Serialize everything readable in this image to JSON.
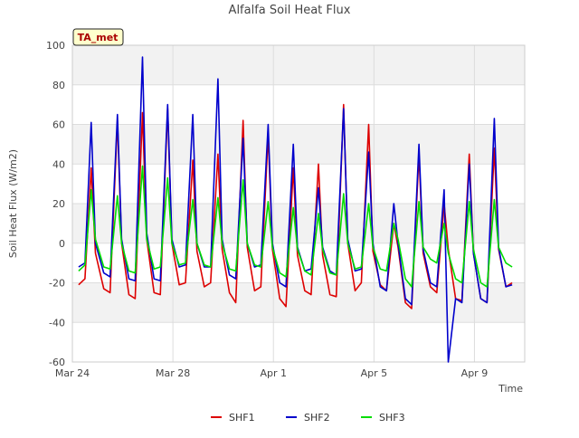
{
  "chart_data": {
    "type": "line",
    "title": "Alfalfa Soil Heat Flux",
    "xlabel": "Time",
    "ylabel": "Soil Heat Flux (W/m2)",
    "annotation": "TA_met",
    "ylim": [
      -60,
      100
    ],
    "yticks": [
      -60,
      -40,
      -20,
      0,
      20,
      40,
      60,
      80,
      100
    ],
    "xlim": [
      "2023-03-24",
      "2023-04-11"
    ],
    "xticks": [
      {
        "date": "2023-03-24",
        "label": "Mar 24"
      },
      {
        "date": "2023-03-28",
        "label": "Mar 28"
      },
      {
        "date": "2023-04-01",
        "label": "Apr 1"
      },
      {
        "date": "2023-04-05",
        "label": "Apr 5"
      },
      {
        "date": "2023-04-09",
        "label": "Apr 9"
      }
    ],
    "grid": true,
    "legend_position": "bottom-center",
    "series": [
      {
        "name": "SHF1",
        "color": "#dd0000",
        "points": [
          [
            "2023-03-24T06:00",
            -21
          ],
          [
            "2023-03-24T12:00",
            -18
          ],
          [
            "2023-03-24T18:00",
            38
          ],
          [
            "2023-03-24T22:00",
            -5
          ],
          [
            "2023-03-25T06:00",
            -23
          ],
          [
            "2023-03-25T12:00",
            -25
          ],
          [
            "2023-03-25T19:00",
            62
          ],
          [
            "2023-03-25T23:00",
            0
          ],
          [
            "2023-03-26T06:00",
            -26
          ],
          [
            "2023-03-26T12:00",
            -28
          ],
          [
            "2023-03-26T19:00",
            66
          ],
          [
            "2023-03-26T23:00",
            2
          ],
          [
            "2023-03-27T06:00",
            -25
          ],
          [
            "2023-03-27T12:00",
            -26
          ],
          [
            "2023-03-27T19:00",
            68
          ],
          [
            "2023-03-27T23:00",
            0
          ],
          [
            "2023-03-28T06:00",
            -21
          ],
          [
            "2023-03-28T12:00",
            -20
          ],
          [
            "2023-03-28T19:00",
            42
          ],
          [
            "2023-03-28T23:00",
            -4
          ],
          [
            "2023-03-29T06:00",
            -22
          ],
          [
            "2023-03-29T12:00",
            -20
          ],
          [
            "2023-03-29T19:00",
            45
          ],
          [
            "2023-03-29T23:00",
            -3
          ],
          [
            "2023-03-30T06:00",
            -25
          ],
          [
            "2023-03-30T12:00",
            -30
          ],
          [
            "2023-03-30T19:00",
            62
          ],
          [
            "2023-03-30T23:00",
            -2
          ],
          [
            "2023-03-31T06:00",
            -24
          ],
          [
            "2023-03-31T12:00",
            -22
          ],
          [
            "2023-03-31T19:00",
            55
          ],
          [
            "2023-03-31T23:00",
            -3
          ],
          [
            "2023-04-01T06:00",
            -28
          ],
          [
            "2023-04-01T12:00",
            -32
          ],
          [
            "2023-04-01T19:00",
            38
          ],
          [
            "2023-04-01T23:00",
            -6
          ],
          [
            "2023-04-02T06:00",
            -24
          ],
          [
            "2023-04-02T12:00",
            -26
          ],
          [
            "2023-04-02T19:00",
            40
          ],
          [
            "2023-04-02T23:00",
            -6
          ],
          [
            "2023-04-03T06:00",
            -26
          ],
          [
            "2023-04-03T12:00",
            -27
          ],
          [
            "2023-04-03T19:00",
            70
          ],
          [
            "2023-04-03T23:00",
            0
          ],
          [
            "2023-04-04T06:00",
            -24
          ],
          [
            "2023-04-04T12:00",
            -20
          ],
          [
            "2023-04-04T19:00",
            60
          ],
          [
            "2023-04-04T23:00",
            -4
          ],
          [
            "2023-04-05T06:00",
            -21
          ],
          [
            "2023-04-05T12:00",
            -24
          ],
          [
            "2023-04-05T19:00",
            10
          ],
          [
            "2023-04-05T23:00",
            -2
          ],
          [
            "2023-04-06T06:00",
            -30
          ],
          [
            "2023-04-06T12:00",
            -33
          ],
          [
            "2023-04-06T19:00",
            45
          ],
          [
            "2023-04-06T23:00",
            -5
          ],
          [
            "2023-04-07T06:00",
            -22
          ],
          [
            "2023-04-07T12:00",
            -25
          ],
          [
            "2023-04-07T19:00",
            20
          ],
          [
            "2023-04-07T23:00",
            -3
          ],
          [
            "2023-04-08T06:00",
            -28
          ],
          [
            "2023-04-08T12:00",
            -29
          ],
          [
            "2023-04-08T19:00",
            45
          ],
          [
            "2023-04-08T23:00",
            -5
          ],
          [
            "2023-04-09T06:00",
            -28
          ],
          [
            "2023-04-09T12:00",
            -30
          ],
          [
            "2023-04-09T19:00",
            48
          ],
          [
            "2023-04-09T23:00",
            -3
          ],
          [
            "2023-04-10T06:00",
            -22
          ],
          [
            "2023-04-10T12:00",
            -20
          ]
        ]
      },
      {
        "name": "SHF2",
        "color": "#0000cc",
        "points": [
          [
            "2023-03-24T06:00",
            -12
          ],
          [
            "2023-03-24T12:00",
            -10
          ],
          [
            "2023-03-24T18:00",
            61
          ],
          [
            "2023-03-24T22:00",
            0
          ],
          [
            "2023-03-25T06:00",
            -15
          ],
          [
            "2023-03-25T12:00",
            -17
          ],
          [
            "2023-03-25T19:00",
            65
          ],
          [
            "2023-03-25T23:00",
            2
          ],
          [
            "2023-03-26T06:00",
            -18
          ],
          [
            "2023-03-26T12:00",
            -19
          ],
          [
            "2023-03-26T19:00",
            94
          ],
          [
            "2023-03-26T23:00",
            5
          ],
          [
            "2023-03-27T06:00",
            -18
          ],
          [
            "2023-03-27T12:00",
            -19
          ],
          [
            "2023-03-27T19:00",
            70
          ],
          [
            "2023-03-27T23:00",
            2
          ],
          [
            "2023-03-28T06:00",
            -12
          ],
          [
            "2023-03-28T12:00",
            -11
          ],
          [
            "2023-03-28T19:00",
            65
          ],
          [
            "2023-03-28T23:00",
            0
          ],
          [
            "2023-03-29T06:00",
            -12
          ],
          [
            "2023-03-29T12:00",
            -12
          ],
          [
            "2023-03-29T19:00",
            83
          ],
          [
            "2023-03-29T23:00",
            2
          ],
          [
            "2023-03-30T06:00",
            -16
          ],
          [
            "2023-03-30T12:00",
            -18
          ],
          [
            "2023-03-30T19:00",
            53
          ],
          [
            "2023-03-30T23:00",
            0
          ],
          [
            "2023-03-31T06:00",
            -12
          ],
          [
            "2023-03-31T12:00",
            -11
          ],
          [
            "2023-03-31T19:00",
            60
          ],
          [
            "2023-03-31T23:00",
            0
          ],
          [
            "2023-04-01T06:00",
            -20
          ],
          [
            "2023-04-01T12:00",
            -22
          ],
          [
            "2023-04-01T19:00",
            50
          ],
          [
            "2023-04-01T23:00",
            -2
          ],
          [
            "2023-04-02T06:00",
            -14
          ],
          [
            "2023-04-02T12:00",
            -13
          ],
          [
            "2023-04-02T19:00",
            28
          ],
          [
            "2023-04-02T23:00",
            -2
          ],
          [
            "2023-04-03T06:00",
            -14
          ],
          [
            "2023-04-03T12:00",
            -16
          ],
          [
            "2023-04-03T19:00",
            68
          ],
          [
            "2023-04-03T23:00",
            2
          ],
          [
            "2023-04-04T06:00",
            -14
          ],
          [
            "2023-04-04T12:00",
            -13
          ],
          [
            "2023-04-04T19:00",
            46
          ],
          [
            "2023-04-04T23:00",
            0
          ],
          [
            "2023-04-05T06:00",
            -22
          ],
          [
            "2023-04-05T12:00",
            -24
          ],
          [
            "2023-04-05T19:00",
            20
          ],
          [
            "2023-04-05T23:00",
            0
          ],
          [
            "2023-04-06T06:00",
            -28
          ],
          [
            "2023-04-06T12:00",
            -31
          ],
          [
            "2023-04-06T19:00",
            50
          ],
          [
            "2023-04-06T23:00",
            -3
          ],
          [
            "2023-04-07T06:00",
            -20
          ],
          [
            "2023-04-07T12:00",
            -22
          ],
          [
            "2023-04-07T19:00",
            27
          ],
          [
            "2023-04-07T23:00",
            -60
          ],
          [
            "2023-04-08T06:00",
            -28
          ],
          [
            "2023-04-08T12:00",
            -30
          ],
          [
            "2023-04-08T19:00",
            40
          ],
          [
            "2023-04-08T23:00",
            -5
          ],
          [
            "2023-04-09T06:00",
            -28
          ],
          [
            "2023-04-09T12:00",
            -30
          ],
          [
            "2023-04-09T19:00",
            63
          ],
          [
            "2023-04-09T23:00",
            -2
          ],
          [
            "2023-04-10T06:00",
            -22
          ],
          [
            "2023-04-10T12:00",
            -21
          ]
        ]
      },
      {
        "name": "SHF3",
        "color": "#00dd00",
        "points": [
          [
            "2023-03-24T06:00",
            -14
          ],
          [
            "2023-03-24T12:00",
            -11
          ],
          [
            "2023-03-24T18:00",
            27
          ],
          [
            "2023-03-24T22:00",
            2
          ],
          [
            "2023-03-25T06:00",
            -12
          ],
          [
            "2023-03-25T12:00",
            -13
          ],
          [
            "2023-03-25T19:00",
            24
          ],
          [
            "2023-03-25T23:00",
            0
          ],
          [
            "2023-03-26T06:00",
            -14
          ],
          [
            "2023-03-26T12:00",
            -15
          ],
          [
            "2023-03-26T19:00",
            39
          ],
          [
            "2023-03-26T23:00",
            2
          ],
          [
            "2023-03-27T06:00",
            -13
          ],
          [
            "2023-03-27T12:00",
            -12
          ],
          [
            "2023-03-27T19:00",
            33
          ],
          [
            "2023-03-27T23:00",
            0
          ],
          [
            "2023-03-28T06:00",
            -11
          ],
          [
            "2023-03-28T12:00",
            -10
          ],
          [
            "2023-03-28T19:00",
            22
          ],
          [
            "2023-03-28T23:00",
            0
          ],
          [
            "2023-03-29T06:00",
            -11
          ],
          [
            "2023-03-29T12:00",
            -12
          ],
          [
            "2023-03-29T19:00",
            23
          ],
          [
            "2023-03-29T23:00",
            0
          ],
          [
            "2023-03-30T06:00",
            -13
          ],
          [
            "2023-03-30T12:00",
            -14
          ],
          [
            "2023-03-30T19:00",
            32
          ],
          [
            "2023-03-30T23:00",
            0
          ],
          [
            "2023-03-31T06:00",
            -11
          ],
          [
            "2023-03-31T12:00",
            -12
          ],
          [
            "2023-03-31T19:00",
            21
          ],
          [
            "2023-03-31T23:00",
            -2
          ],
          [
            "2023-04-01T06:00",
            -15
          ],
          [
            "2023-04-01T12:00",
            -17
          ],
          [
            "2023-04-01T19:00",
            18
          ],
          [
            "2023-04-01T23:00",
            -3
          ],
          [
            "2023-04-02T06:00",
            -14
          ],
          [
            "2023-04-02T12:00",
            -16
          ],
          [
            "2023-04-02T19:00",
            15
          ],
          [
            "2023-04-02T23:00",
            -3
          ],
          [
            "2023-04-03T06:00",
            -15
          ],
          [
            "2023-04-03T12:00",
            -16
          ],
          [
            "2023-04-03T19:00",
            25
          ],
          [
            "2023-04-03T23:00",
            0
          ],
          [
            "2023-04-04T06:00",
            -13
          ],
          [
            "2023-04-04T12:00",
            -12
          ],
          [
            "2023-04-04T19:00",
            20
          ],
          [
            "2023-04-04T23:00",
            -2
          ],
          [
            "2023-04-05T06:00",
            -13
          ],
          [
            "2023-04-05T12:00",
            -14
          ],
          [
            "2023-04-05T19:00",
            10
          ],
          [
            "2023-04-05T23:00",
            2
          ],
          [
            "2023-04-06T06:00",
            -18
          ],
          [
            "2023-04-06T12:00",
            -22
          ],
          [
            "2023-04-06T19:00",
            21
          ],
          [
            "2023-04-06T23:00",
            -2
          ],
          [
            "2023-04-07T06:00",
            -8
          ],
          [
            "2023-04-07T12:00",
            -10
          ],
          [
            "2023-04-07T19:00",
            10
          ],
          [
            "2023-04-07T23:00",
            -5
          ],
          [
            "2023-04-08T06:00",
            -18
          ],
          [
            "2023-04-08T12:00",
            -20
          ],
          [
            "2023-04-08T19:00",
            21
          ],
          [
            "2023-04-08T23:00",
            -3
          ],
          [
            "2023-04-09T06:00",
            -20
          ],
          [
            "2023-04-09T12:00",
            -22
          ],
          [
            "2023-04-09T19:00",
            22
          ],
          [
            "2023-04-09T23:00",
            -2
          ],
          [
            "2023-04-10T06:00",
            -10
          ],
          [
            "2023-04-10T12:00",
            -12
          ]
        ]
      }
    ]
  }
}
